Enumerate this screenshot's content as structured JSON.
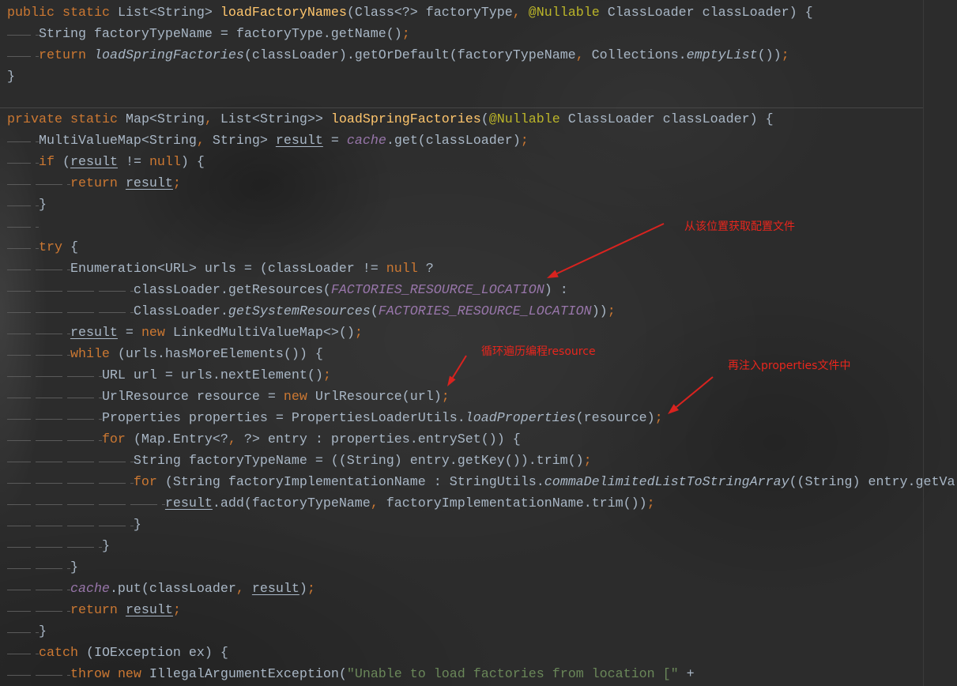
{
  "editor": {
    "language": "java",
    "syntax_colors": {
      "keyword": "#cc7832",
      "plain": "#a9b7c6",
      "method-declaration": "#ffc66d",
      "annotation": "#bbb529",
      "static-field": "#9876aa",
      "static-call": "#a9b7c6",
      "string": "#6a8759",
      "reassigned-variable": "#a9b7c6",
      "punctuation": "#cc7832"
    },
    "code": {
      "lines": [
        {
          "indent": 0,
          "tokens": [
            {
              "type": "keyword",
              "text": "public"
            },
            {
              "type": "plain",
              "text": " "
            },
            {
              "type": "keyword",
              "text": "static"
            },
            {
              "type": "plain",
              "text": " List<String> "
            },
            {
              "type": "method-declaration",
              "text": "loadFactoryNames"
            },
            {
              "type": "plain",
              "text": "(Class<?> factoryType"
            },
            {
              "type": "punctuation",
              "text": ","
            },
            {
              "type": "plain",
              "text": " "
            },
            {
              "type": "annotation",
              "text": "@Nullable"
            },
            {
              "type": "plain",
              "text": " ClassLoader classLoader) {"
            }
          ]
        },
        {
          "indent": 1,
          "tokens": [
            {
              "type": "plain",
              "text": "String factoryTypeName = factoryType.getName()"
            },
            {
              "type": "punctuation",
              "text": ";"
            }
          ]
        },
        {
          "indent": 1,
          "tokens": [
            {
              "type": "keyword",
              "text": "return"
            },
            {
              "type": "plain",
              "text": " "
            },
            {
              "type": "static-call",
              "text": "loadSpringFactories"
            },
            {
              "type": "plain",
              "text": "(classLoader).getOrDefault(factoryTypeName"
            },
            {
              "type": "punctuation",
              "text": ","
            },
            {
              "type": "plain",
              "text": " Collections."
            },
            {
              "type": "static-call",
              "text": "emptyList"
            },
            {
              "type": "plain",
              "text": "())"
            },
            {
              "type": "punctuation",
              "text": ";"
            }
          ]
        },
        {
          "indent": 0,
          "tokens": [
            {
              "type": "plain",
              "text": "}"
            }
          ]
        },
        {
          "indent": 0,
          "tokens": []
        },
        {
          "indent": 0,
          "tokens": [
            {
              "type": "keyword",
              "text": "private"
            },
            {
              "type": "plain",
              "text": " "
            },
            {
              "type": "keyword",
              "text": "static"
            },
            {
              "type": "plain",
              "text": " Map<String"
            },
            {
              "type": "punctuation",
              "text": ","
            },
            {
              "type": "plain",
              "text": " List<String>> "
            },
            {
              "type": "method-declaration",
              "text": "loadSpringFactories"
            },
            {
              "type": "plain",
              "text": "("
            },
            {
              "type": "annotation",
              "text": "@Nullable"
            },
            {
              "type": "plain",
              "text": " ClassLoader classLoader) {"
            }
          ]
        },
        {
          "indent": 1,
          "tokens": [
            {
              "type": "plain",
              "text": "MultiValueMap<String"
            },
            {
              "type": "punctuation",
              "text": ","
            },
            {
              "type": "plain",
              "text": " String> "
            },
            {
              "type": "reassigned-variable",
              "text": "result"
            },
            {
              "type": "plain",
              "text": " = "
            },
            {
              "type": "static-field",
              "text": "cache"
            },
            {
              "type": "plain",
              "text": ".get(classLoader)"
            },
            {
              "type": "punctuation",
              "text": ";"
            }
          ]
        },
        {
          "indent": 1,
          "tokens": [
            {
              "type": "keyword",
              "text": "if"
            },
            {
              "type": "plain",
              "text": " ("
            },
            {
              "type": "reassigned-variable",
              "text": "result"
            },
            {
              "type": "plain",
              "text": " != "
            },
            {
              "type": "keyword",
              "text": "null"
            },
            {
              "type": "plain",
              "text": ") {"
            }
          ]
        },
        {
          "indent": 2,
          "tokens": [
            {
              "type": "keyword",
              "text": "return"
            },
            {
              "type": "plain",
              "text": " "
            },
            {
              "type": "reassigned-variable",
              "text": "result"
            },
            {
              "type": "punctuation",
              "text": ";"
            }
          ]
        },
        {
          "indent": 1,
          "tokens": [
            {
              "type": "plain",
              "text": "}"
            }
          ]
        },
        {
          "indent": 1,
          "tokens": []
        },
        {
          "indent": 1,
          "tokens": [
            {
              "type": "keyword",
              "text": "try"
            },
            {
              "type": "plain",
              "text": " {"
            }
          ]
        },
        {
          "indent": 2,
          "tokens": [
            {
              "type": "plain",
              "text": "Enumeration<URL> urls = (classLoader != "
            },
            {
              "type": "keyword",
              "text": "null"
            },
            {
              "type": "plain",
              "text": " ?"
            }
          ]
        },
        {
          "indent": 4,
          "tokens": [
            {
              "type": "plain",
              "text": "classLoader.getResources("
            },
            {
              "type": "static-field",
              "text": "FACTORIES_RESOURCE_LOCATION"
            },
            {
              "type": "plain",
              "text": ") :"
            }
          ]
        },
        {
          "indent": 4,
          "tokens": [
            {
              "type": "plain",
              "text": "ClassLoader."
            },
            {
              "type": "static-call",
              "text": "getSystemResources"
            },
            {
              "type": "plain",
              "text": "("
            },
            {
              "type": "static-field",
              "text": "FACTORIES_RESOURCE_LOCATION"
            },
            {
              "type": "plain",
              "text": "))"
            },
            {
              "type": "punctuation",
              "text": ";"
            }
          ]
        },
        {
          "indent": 2,
          "tokens": [
            {
              "type": "reassigned-variable",
              "text": "result"
            },
            {
              "type": "plain",
              "text": " = "
            },
            {
              "type": "keyword",
              "text": "new"
            },
            {
              "type": "plain",
              "text": " LinkedMultiValueMap<>()"
            },
            {
              "type": "punctuation",
              "text": ";"
            }
          ]
        },
        {
          "indent": 2,
          "tokens": [
            {
              "type": "keyword",
              "text": "while"
            },
            {
              "type": "plain",
              "text": " (urls.hasMoreElements()) {"
            }
          ]
        },
        {
          "indent": 3,
          "tokens": [
            {
              "type": "plain",
              "text": "URL url = urls.nextElement()"
            },
            {
              "type": "punctuation",
              "text": ";"
            }
          ]
        },
        {
          "indent": 3,
          "tokens": [
            {
              "type": "plain",
              "text": "UrlResource resource = "
            },
            {
              "type": "keyword",
              "text": "new"
            },
            {
              "type": "plain",
              "text": " UrlResource(url)"
            },
            {
              "type": "punctuation",
              "text": ";"
            }
          ]
        },
        {
          "indent": 3,
          "tokens": [
            {
              "type": "plain",
              "text": "Properties properties = PropertiesLoaderUtils."
            },
            {
              "type": "static-call",
              "text": "loadProperties"
            },
            {
              "type": "plain",
              "text": "(resource)"
            },
            {
              "type": "punctuation",
              "text": ";"
            }
          ]
        },
        {
          "indent": 3,
          "tokens": [
            {
              "type": "keyword",
              "text": "for"
            },
            {
              "type": "plain",
              "text": " (Map.Entry<?"
            },
            {
              "type": "punctuation",
              "text": ","
            },
            {
              "type": "plain",
              "text": " ?> entry : properties.entrySet()) {"
            }
          ]
        },
        {
          "indent": 4,
          "tokens": [
            {
              "type": "plain",
              "text": "String factoryTypeName = ((String) entry.getKey()).trim()"
            },
            {
              "type": "punctuation",
              "text": ";"
            }
          ]
        },
        {
          "indent": 4,
          "tokens": [
            {
              "type": "keyword",
              "text": "for"
            },
            {
              "type": "plain",
              "text": " (String factoryImplementationName : StringUtils."
            },
            {
              "type": "static-call",
              "text": "commaDelimitedListToStringArray"
            },
            {
              "type": "plain",
              "text": "((String) entry.getVa"
            }
          ]
        },
        {
          "indent": 5,
          "tokens": [
            {
              "type": "reassigned-variable",
              "text": "result"
            },
            {
              "type": "plain",
              "text": ".add(factoryTypeName"
            },
            {
              "type": "punctuation",
              "text": ","
            },
            {
              "type": "plain",
              "text": " factoryImplementationName.trim())"
            },
            {
              "type": "punctuation",
              "text": ";"
            }
          ]
        },
        {
          "indent": 4,
          "tokens": [
            {
              "type": "plain",
              "text": "}"
            }
          ]
        },
        {
          "indent": 3,
          "tokens": [
            {
              "type": "plain",
              "text": "}"
            }
          ]
        },
        {
          "indent": 2,
          "tokens": [
            {
              "type": "plain",
              "text": "}"
            }
          ]
        },
        {
          "indent": 2,
          "tokens": [
            {
              "type": "static-field",
              "text": "cache"
            },
            {
              "type": "plain",
              "text": ".put(classLoader"
            },
            {
              "type": "punctuation",
              "text": ","
            },
            {
              "type": "plain",
              "text": " "
            },
            {
              "type": "reassigned-variable",
              "text": "result"
            },
            {
              "type": "plain",
              "text": ")"
            },
            {
              "type": "punctuation",
              "text": ";"
            }
          ]
        },
        {
          "indent": 2,
          "tokens": [
            {
              "type": "keyword",
              "text": "return"
            },
            {
              "type": "plain",
              "text": " "
            },
            {
              "type": "reassigned-variable",
              "text": "result"
            },
            {
              "type": "punctuation",
              "text": ";"
            }
          ]
        },
        {
          "indent": 1,
          "tokens": [
            {
              "type": "plain",
              "text": "}"
            }
          ]
        },
        {
          "indent": 1,
          "tokens": [
            {
              "type": "keyword",
              "text": "catch"
            },
            {
              "type": "plain",
              "text": " (IOException ex) {"
            }
          ]
        },
        {
          "indent": 2,
          "tokens": [
            {
              "type": "keyword",
              "text": "throw"
            },
            {
              "type": "plain",
              "text": " "
            },
            {
              "type": "keyword",
              "text": "new"
            },
            {
              "type": "plain",
              "text": " IllegalArgumentException("
            },
            {
              "type": "string",
              "text": "\"Unable to load factories from location [\""
            },
            {
              "type": "plain",
              "text": " +"
            }
          ]
        }
      ]
    }
  },
  "annotations": {
    "color": "#e8261d",
    "arrow_color": "#d9231f",
    "notes": [
      {
        "text": "从该位置获取配置文件"
      },
      {
        "text": "循环遍历编程resource"
      },
      {
        "text": "再注入properties文件中"
      }
    ]
  }
}
